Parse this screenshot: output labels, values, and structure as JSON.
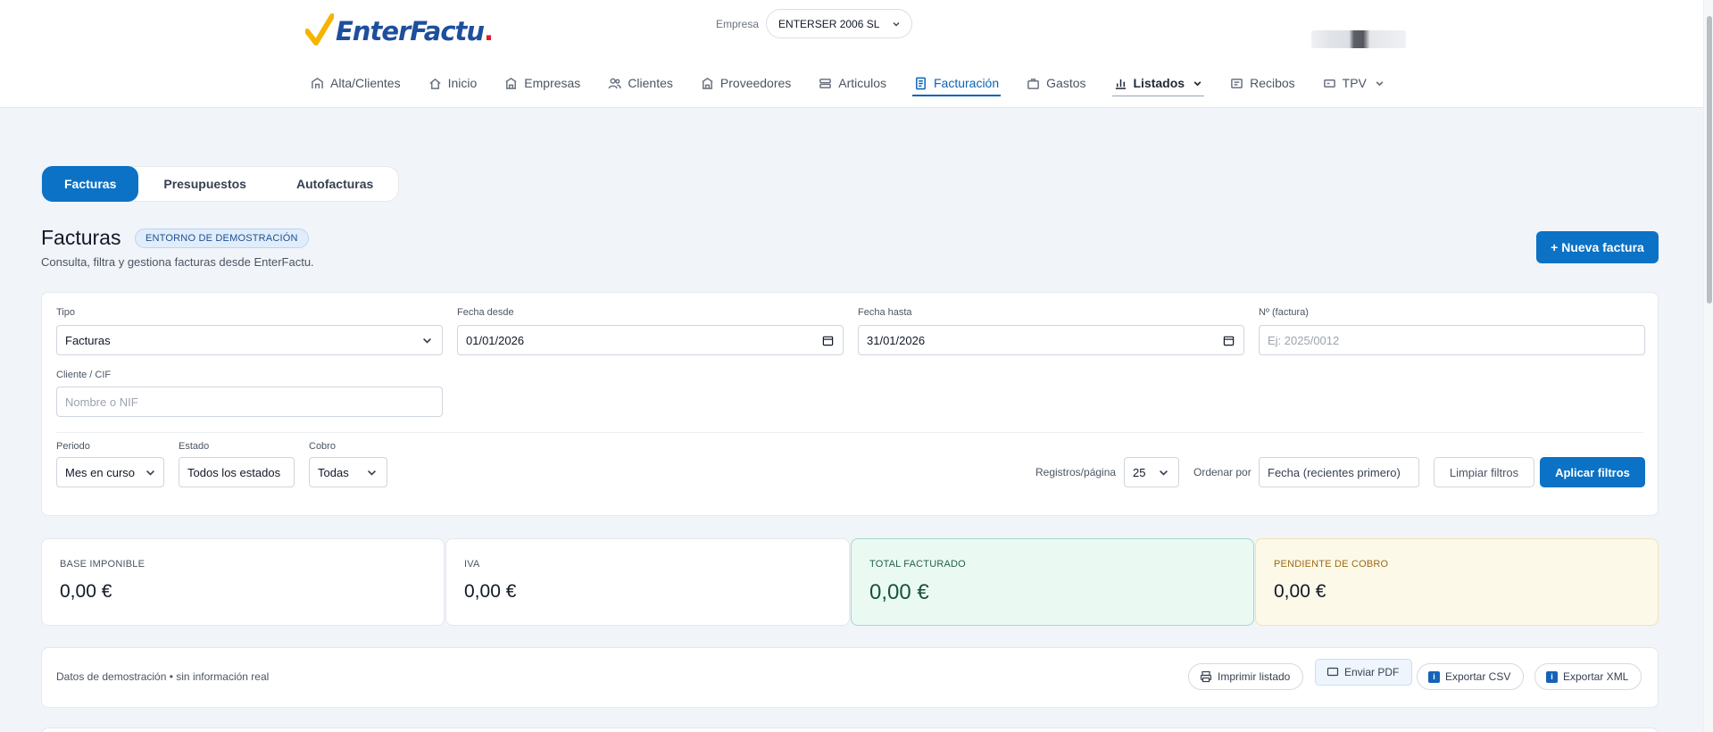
{
  "header": {
    "logo_text": "EnterFactu",
    "logo_dot": ".",
    "company_label": "Empresa",
    "company_value": "ENTERSER 2006 SL",
    "nav": [
      {
        "label": "Alta/Clientes",
        "icon": "building-icon"
      },
      {
        "label": "Inicio",
        "icon": "home-icon"
      },
      {
        "label": "Empresas",
        "icon": "store-icon"
      },
      {
        "label": "Clientes",
        "icon": "users-icon"
      },
      {
        "label": "Proveedores",
        "icon": "store-icon"
      },
      {
        "label": "Articulos",
        "icon": "layers-icon"
      },
      {
        "label": "Facturación",
        "icon": "invoice-icon",
        "active": true
      },
      {
        "label": "Gastos",
        "icon": "briefcase-icon"
      },
      {
        "label": "Listados",
        "icon": "bar-chart-icon",
        "dropdown": true
      },
      {
        "label": "Recibos",
        "icon": "receipt-icon"
      },
      {
        "label": "TPV",
        "icon": "pos-icon",
        "dropdown": true
      }
    ]
  },
  "tabs": [
    "Facturas",
    "Presupuestos",
    "Autofacturas"
  ],
  "page": {
    "title": "Facturas",
    "badge": "ENTORNO DE DEMOSTRACIÓN",
    "subtitle": "Consulta, filtra y gestiona facturas desde EnterFactu.",
    "new_button": "+ Nueva factura"
  },
  "filters": {
    "tipo_label": "Tipo",
    "tipo_value": "Facturas",
    "fecha_desde_label": "Fecha desde",
    "fecha_desde_value": "01/01/2026",
    "fecha_hasta_label": "Fecha hasta",
    "fecha_hasta_value": "31/01/2026",
    "numero_label": "Nº (factura)",
    "numero_placeholder": "Ej: 2025/0012",
    "cliente_label": "Cliente / CIF",
    "cliente_placeholder": "Nombre o NIF",
    "periodo_label": "Periodo",
    "periodo_value": "Mes en curso",
    "estado_label": "Estado",
    "estado_value": "Todos los estados",
    "cobro_label": "Cobro",
    "cobro_value": "Todas",
    "registros_label": "Registros/página",
    "registros_value": "25",
    "ordenar_label": "Ordenar por",
    "ordenar_value": "Fecha (recientes primero)",
    "clear_button": "Limpiar filtros",
    "apply_button": "Aplicar filtros"
  },
  "summary": [
    {
      "label": "BASE IMPONIBLE",
      "value": "0,00 €"
    },
    {
      "label": "IVA",
      "value": "0,00 €"
    },
    {
      "label": "TOTAL FACTURADO",
      "value": "0,00 €"
    },
    {
      "label": "PENDIENTE DE COBRO",
      "value": "0,00 €"
    }
  ],
  "actions": {
    "note": "Datos de demostración • sin información real",
    "print": "Imprimir listado",
    "pdf": "Enviar PDF",
    "csv": "Exportar CSV",
    "xml": "Exportar XML"
  },
  "colors": {
    "accent": "#0b72c6",
    "success_bg": "#eafaf3",
    "warning_bg": "#fdf9e9"
  }
}
